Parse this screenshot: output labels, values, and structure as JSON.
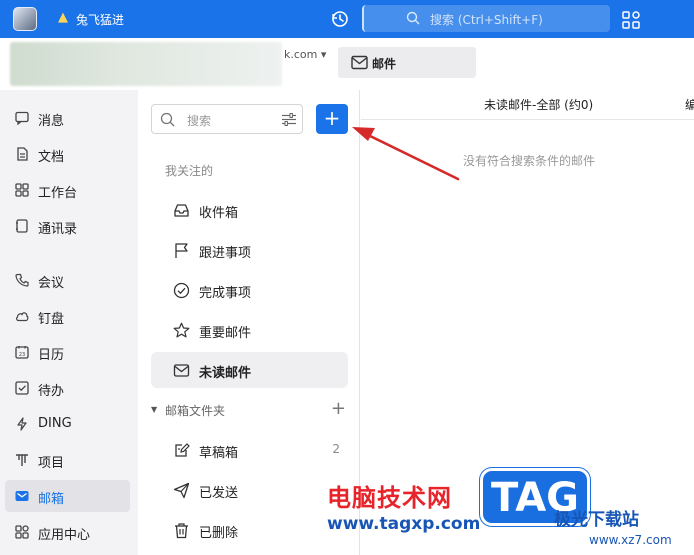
{
  "topbar": {
    "org_name": "兔飞猛进",
    "search_placeholder": "搜索 (Ctrl+Shift+F)"
  },
  "account": {
    "domain_suffix": "k.com ▾"
  },
  "mail_tab": {
    "label": "邮件"
  },
  "nav": {
    "items": [
      {
        "label": "消息",
        "icon": "message-icon"
      },
      {
        "label": "文档",
        "icon": "document-icon"
      },
      {
        "label": "工作台",
        "icon": "workbench-icon"
      },
      {
        "label": "通讯录",
        "icon": "contacts-icon"
      },
      {
        "label": "会议",
        "icon": "phone-icon"
      },
      {
        "label": "钉盘",
        "icon": "cloud-icon"
      },
      {
        "label": "日历",
        "icon": "calendar-icon"
      },
      {
        "label": "待办",
        "icon": "todo-icon"
      },
      {
        "label": "DING",
        "icon": "lightning-icon"
      },
      {
        "label": "项目",
        "icon": "project-icon"
      },
      {
        "label": "邮箱",
        "icon": "mail-icon",
        "active": true
      },
      {
        "label": "应用中心",
        "icon": "app-center-icon"
      }
    ]
  },
  "folders": {
    "search_placeholder": "搜索",
    "compose_symbol": "+",
    "section_heading": "我关注的",
    "items": [
      {
        "label": "收件箱",
        "icon": "inbox-icon"
      },
      {
        "label": "跟进事项",
        "icon": "flag-icon"
      },
      {
        "label": "完成事项",
        "icon": "check-circle-icon"
      },
      {
        "label": "重要邮件",
        "icon": "star-icon"
      },
      {
        "label": "未读邮件",
        "icon": "envelope-icon",
        "active": true
      }
    ],
    "mailbox_heading": "邮箱文件夹",
    "mailbox_items": [
      {
        "label": "草稿箱",
        "icon": "draft-icon",
        "count": "2"
      },
      {
        "label": "已发送",
        "icon": "send-icon",
        "count": ""
      },
      {
        "label": "已删除",
        "icon": "trash-icon",
        "count": ""
      }
    ]
  },
  "list": {
    "header_title": "未读邮件-全部 (约0)",
    "header_edit": "编",
    "empty_message": "没有符合搜索条件的邮件"
  },
  "watermark": {
    "cn_text": "电脑技术网",
    "url": "www.tagxp.com",
    "tag": "TAG",
    "site": "极光下载站",
    "domain": "www.xz7.com"
  },
  "colors": {
    "accent": "#1a73e8",
    "arrow": "#d42a2a",
    "watermark_red": "#e8242b",
    "watermark_blue": "#1856b5"
  }
}
